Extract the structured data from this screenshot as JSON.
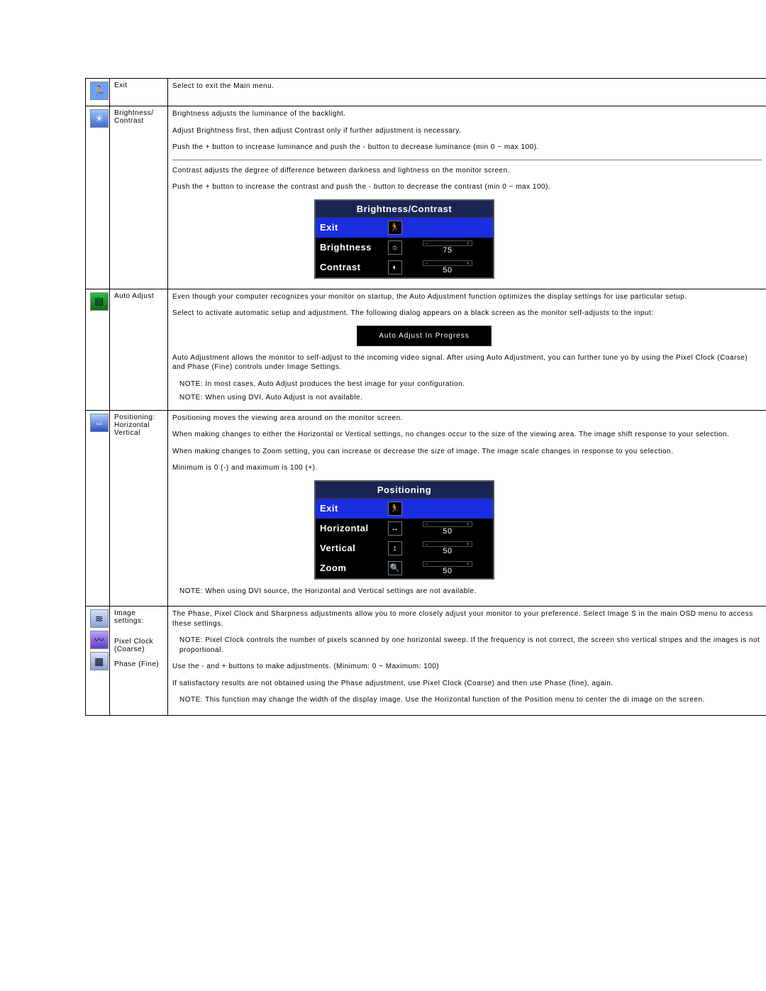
{
  "rows": {
    "exit": {
      "label": "Exit",
      "desc": "Select to exit the Main menu."
    },
    "brightness": {
      "label": "Brightness/\nContrast",
      "p1": "Brightness adjusts the luminance of the backlight.",
      "p2": "Adjust Brightness first, then adjust Contrast only if further adjustment is necessary.",
      "p3": "Push the + button to increase luminance and push the - button to decrease luminance (min 0 ~ max 100).",
      "p4": "Contrast adjusts the degree of difference between darkness and lightness on the monitor screen.",
      "p5": "Push the + button to increase the contrast and push the - button to decrease the contrast (min 0 ~ max 100)."
    },
    "auto": {
      "label": "Auto Adjust",
      "p1": "Even though your computer recognizes your monitor on startup, the Auto Adjustment function optimizes the display settings for use particular setup.",
      "p2": "Select to activate automatic setup and adjustment. The following dialog appears on a black screen as the monitor self-adjusts to the input:",
      "progress": "Auto Adjust In Progress",
      "p3": "Auto Adjustment allows the monitor to self-adjust to the incoming video signal. After using Auto Adjustment, you can further tune yo by using the Pixel Clock (Coarse) and Phase (Fine) controls under Image Settings.",
      "n1": "NOTE: In most cases, Auto Adjust produces the best image for your configuration.",
      "n2": "NOTE: When using DVI, Auto Adjust is not available."
    },
    "position": {
      "label": "Positioning:\nHorizontal\nVertical",
      "p1": "Positioning moves the viewing area around on the monitor screen.",
      "p2": "When making changes to either the Horizontal or Vertical settings, no changes occur to the size of the viewing area. The image shift response to your selection.",
      "p3": "When making changes to Zoom setting, you can increase or decrease the size of image. The image scale changes in response to you selection.",
      "p4": "Minimum is 0 (-) and maximum is 100 (+).",
      "n1": "NOTE: When using DVI source, the Horizontal and Vertical settings are not available."
    },
    "image": {
      "label1": "Image settings:",
      "label2": "Pixel Clock (Coarse)",
      "label3": "Phase (Fine)",
      "p1": "The Phase, Pixel Clock and Sharpness adjustments allow you to more closely adjust your monitor to your preference. Select Image S in the main OSD menu to access these settings.",
      "p2": "NOTE: Pixel Clock controls the number of pixels scanned by one horizontal sweep. If the frequency is not correct, the screen sho vertical stripes and the images is not proportional.",
      "p3": "Use the - and + buttons to make adjustments. (Minimum: 0 ~ Maximum: 100)",
      "p4": "If satisfactory results are not obtained using the Phase adjustment, use Pixel Clock (Coarse) and then use Phase (fine), again.",
      "p5": "NOTE: This function may change the width of the display image. Use the Horizontal function of the Position menu to center the di image on the screen."
    }
  },
  "osd1": {
    "title": "Brightness/Contrast",
    "exit": "Exit",
    "rows": [
      {
        "label": "Brightness",
        "glyph": "☼",
        "value": "75"
      },
      {
        "label": "Contrast",
        "glyph": "◐",
        "value": "50"
      }
    ]
  },
  "osd2": {
    "title": "Positioning",
    "exit": "Exit",
    "rows": [
      {
        "label": "Horizontal",
        "glyph": "↔",
        "value": "50"
      },
      {
        "label": "Vertical",
        "glyph": "↕",
        "value": "50"
      },
      {
        "label": "Zoom",
        "glyph": "🔍",
        "value": "50"
      }
    ]
  }
}
